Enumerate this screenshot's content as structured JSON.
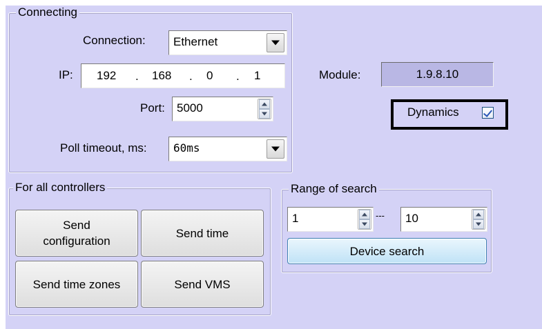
{
  "connecting": {
    "title": "Connecting",
    "connection_label": "Connection:",
    "connection_value": "Ethernet",
    "ip_label": "IP:",
    "ip_octets": [
      "192",
      "168",
      "0",
      "1"
    ],
    "ip_sep": ".",
    "port_label": "Port:",
    "port_value": "5000",
    "poll_label": "Poll timeout, ms:",
    "poll_value": "60ms"
  },
  "module": {
    "label": "Module:",
    "value": "1.9.8.10"
  },
  "dynamics": {
    "label": "Dynamics",
    "checked": true
  },
  "controllers": {
    "title": "For all controllers",
    "send_configuration": "Send\nconfiguration",
    "send_time": "Send time",
    "send_time_zones": "Send time zones",
    "send_vms": "Send VMS"
  },
  "search": {
    "title": "Range of search",
    "from_value": "1",
    "dash": "---",
    "to_value": "10",
    "device_search": "Device search"
  }
}
